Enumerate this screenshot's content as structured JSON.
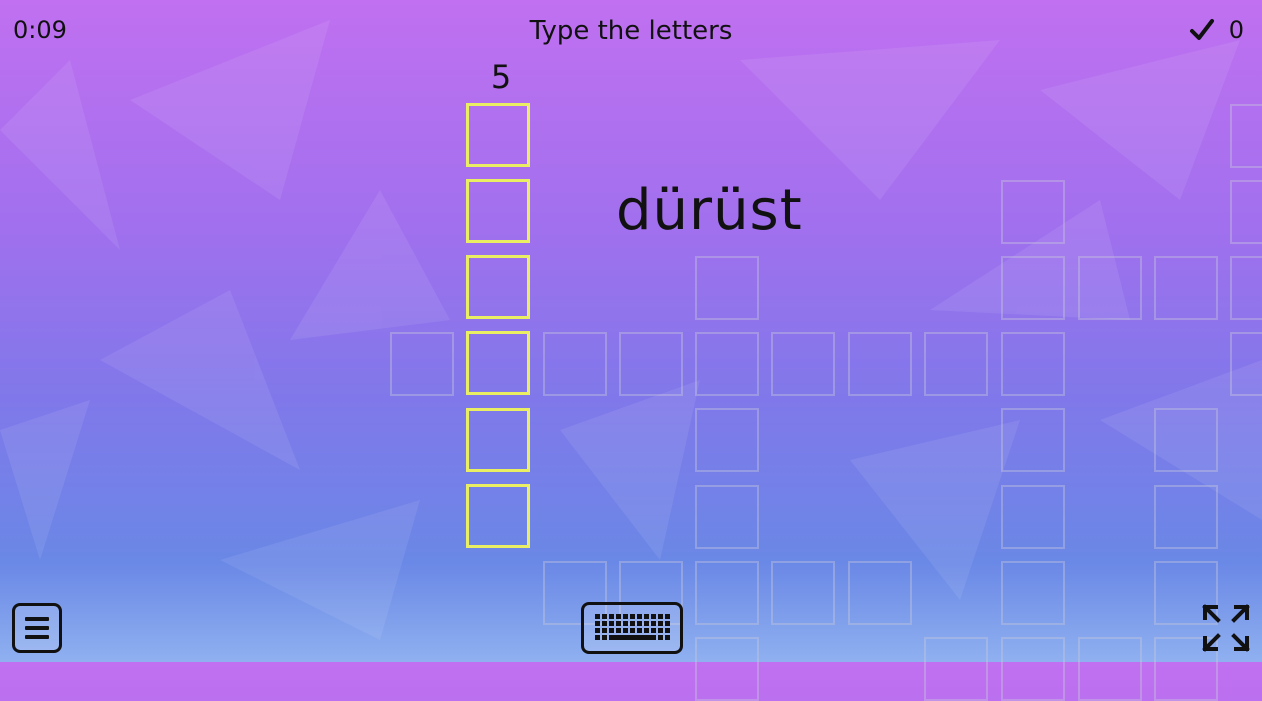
{
  "header": {
    "timer": "0:09",
    "instruction": "Type the letters",
    "score": "0"
  },
  "clue": {
    "number": "5",
    "word": "dürüst"
  },
  "colors": {
    "active_cell_border": "#e9ee63",
    "inactive_cell_border": "rgba(200,200,220,0.40)",
    "text": "#111111"
  },
  "icons": {
    "score": "check-icon",
    "menu": "hamburger-menu-icon",
    "keyboard": "keyboard-icon",
    "fullscreen": "fullscreen-icon"
  }
}
